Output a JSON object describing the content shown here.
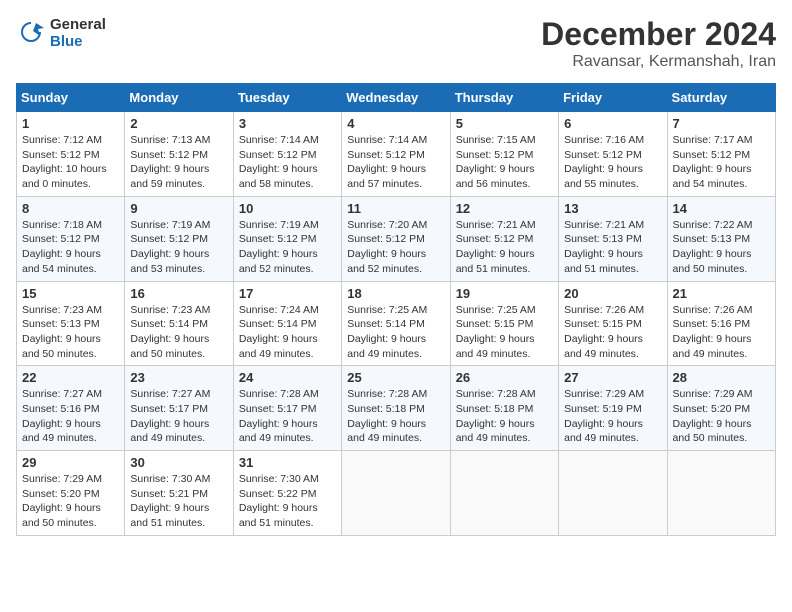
{
  "logo": {
    "line1": "General",
    "line2": "Blue"
  },
  "title": "December 2024",
  "subtitle": "Ravansar, Kermanshah, Iran",
  "weekdays": [
    "Sunday",
    "Monday",
    "Tuesday",
    "Wednesday",
    "Thursday",
    "Friday",
    "Saturday"
  ],
  "weeks": [
    [
      {
        "day": "1",
        "sunrise": "Sunrise: 7:12 AM",
        "sunset": "Sunset: 5:12 PM",
        "daylight": "Daylight: 10 hours and 0 minutes."
      },
      {
        "day": "2",
        "sunrise": "Sunrise: 7:13 AM",
        "sunset": "Sunset: 5:12 PM",
        "daylight": "Daylight: 9 hours and 59 minutes."
      },
      {
        "day": "3",
        "sunrise": "Sunrise: 7:14 AM",
        "sunset": "Sunset: 5:12 PM",
        "daylight": "Daylight: 9 hours and 58 minutes."
      },
      {
        "day": "4",
        "sunrise": "Sunrise: 7:14 AM",
        "sunset": "Sunset: 5:12 PM",
        "daylight": "Daylight: 9 hours and 57 minutes."
      },
      {
        "day": "5",
        "sunrise": "Sunrise: 7:15 AM",
        "sunset": "Sunset: 5:12 PM",
        "daylight": "Daylight: 9 hours and 56 minutes."
      },
      {
        "day": "6",
        "sunrise": "Sunrise: 7:16 AM",
        "sunset": "Sunset: 5:12 PM",
        "daylight": "Daylight: 9 hours and 55 minutes."
      },
      {
        "day": "7",
        "sunrise": "Sunrise: 7:17 AM",
        "sunset": "Sunset: 5:12 PM",
        "daylight": "Daylight: 9 hours and 54 minutes."
      }
    ],
    [
      {
        "day": "8",
        "sunrise": "Sunrise: 7:18 AM",
        "sunset": "Sunset: 5:12 PM",
        "daylight": "Daylight: 9 hours and 54 minutes."
      },
      {
        "day": "9",
        "sunrise": "Sunrise: 7:19 AM",
        "sunset": "Sunset: 5:12 PM",
        "daylight": "Daylight: 9 hours and 53 minutes."
      },
      {
        "day": "10",
        "sunrise": "Sunrise: 7:19 AM",
        "sunset": "Sunset: 5:12 PM",
        "daylight": "Daylight: 9 hours and 52 minutes."
      },
      {
        "day": "11",
        "sunrise": "Sunrise: 7:20 AM",
        "sunset": "Sunset: 5:12 PM",
        "daylight": "Daylight: 9 hours and 52 minutes."
      },
      {
        "day": "12",
        "sunrise": "Sunrise: 7:21 AM",
        "sunset": "Sunset: 5:12 PM",
        "daylight": "Daylight: 9 hours and 51 minutes."
      },
      {
        "day": "13",
        "sunrise": "Sunrise: 7:21 AM",
        "sunset": "Sunset: 5:13 PM",
        "daylight": "Daylight: 9 hours and 51 minutes."
      },
      {
        "day": "14",
        "sunrise": "Sunrise: 7:22 AM",
        "sunset": "Sunset: 5:13 PM",
        "daylight": "Daylight: 9 hours and 50 minutes."
      }
    ],
    [
      {
        "day": "15",
        "sunrise": "Sunrise: 7:23 AM",
        "sunset": "Sunset: 5:13 PM",
        "daylight": "Daylight: 9 hours and 50 minutes."
      },
      {
        "day": "16",
        "sunrise": "Sunrise: 7:23 AM",
        "sunset": "Sunset: 5:14 PM",
        "daylight": "Daylight: 9 hours and 50 minutes."
      },
      {
        "day": "17",
        "sunrise": "Sunrise: 7:24 AM",
        "sunset": "Sunset: 5:14 PM",
        "daylight": "Daylight: 9 hours and 49 minutes."
      },
      {
        "day": "18",
        "sunrise": "Sunrise: 7:25 AM",
        "sunset": "Sunset: 5:14 PM",
        "daylight": "Daylight: 9 hours and 49 minutes."
      },
      {
        "day": "19",
        "sunrise": "Sunrise: 7:25 AM",
        "sunset": "Sunset: 5:15 PM",
        "daylight": "Daylight: 9 hours and 49 minutes."
      },
      {
        "day": "20",
        "sunrise": "Sunrise: 7:26 AM",
        "sunset": "Sunset: 5:15 PM",
        "daylight": "Daylight: 9 hours and 49 minutes."
      },
      {
        "day": "21",
        "sunrise": "Sunrise: 7:26 AM",
        "sunset": "Sunset: 5:16 PM",
        "daylight": "Daylight: 9 hours and 49 minutes."
      }
    ],
    [
      {
        "day": "22",
        "sunrise": "Sunrise: 7:27 AM",
        "sunset": "Sunset: 5:16 PM",
        "daylight": "Daylight: 9 hours and 49 minutes."
      },
      {
        "day": "23",
        "sunrise": "Sunrise: 7:27 AM",
        "sunset": "Sunset: 5:17 PM",
        "daylight": "Daylight: 9 hours and 49 minutes."
      },
      {
        "day": "24",
        "sunrise": "Sunrise: 7:28 AM",
        "sunset": "Sunset: 5:17 PM",
        "daylight": "Daylight: 9 hours and 49 minutes."
      },
      {
        "day": "25",
        "sunrise": "Sunrise: 7:28 AM",
        "sunset": "Sunset: 5:18 PM",
        "daylight": "Daylight: 9 hours and 49 minutes."
      },
      {
        "day": "26",
        "sunrise": "Sunrise: 7:28 AM",
        "sunset": "Sunset: 5:18 PM",
        "daylight": "Daylight: 9 hours and 49 minutes."
      },
      {
        "day": "27",
        "sunrise": "Sunrise: 7:29 AM",
        "sunset": "Sunset: 5:19 PM",
        "daylight": "Daylight: 9 hours and 49 minutes."
      },
      {
        "day": "28",
        "sunrise": "Sunrise: 7:29 AM",
        "sunset": "Sunset: 5:20 PM",
        "daylight": "Daylight: 9 hours and 50 minutes."
      }
    ],
    [
      {
        "day": "29",
        "sunrise": "Sunrise: 7:29 AM",
        "sunset": "Sunset: 5:20 PM",
        "daylight": "Daylight: 9 hours and 50 minutes."
      },
      {
        "day": "30",
        "sunrise": "Sunrise: 7:30 AM",
        "sunset": "Sunset: 5:21 PM",
        "daylight": "Daylight: 9 hours and 51 minutes."
      },
      {
        "day": "31",
        "sunrise": "Sunrise: 7:30 AM",
        "sunset": "Sunset: 5:22 PM",
        "daylight": "Daylight: 9 hours and 51 minutes."
      },
      null,
      null,
      null,
      null
    ]
  ]
}
